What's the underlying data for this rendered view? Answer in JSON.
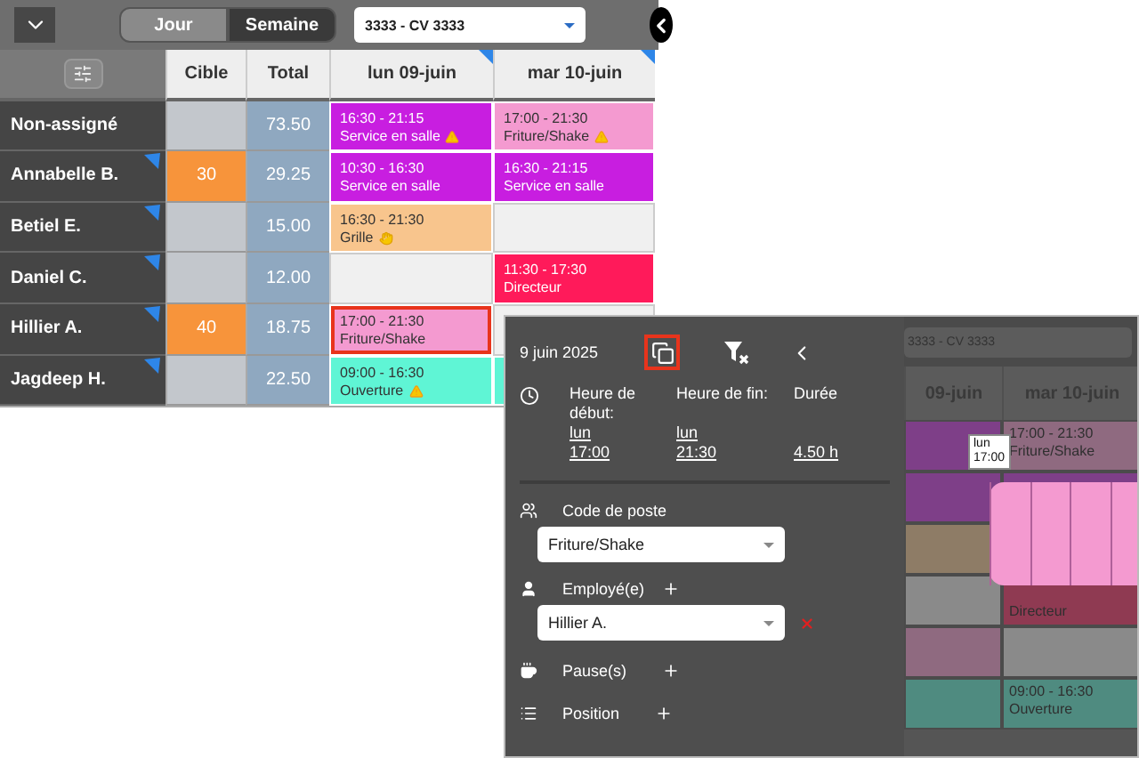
{
  "toolbar": {
    "views": [
      {
        "label": "Jour",
        "selected": false
      },
      {
        "label": "Semaine",
        "selected": true
      }
    ],
    "location": "3333 - CV 3333"
  },
  "grid": {
    "columns": [
      {
        "label": "Cible",
        "kind": "plain"
      },
      {
        "label": "Total",
        "kind": "plain"
      },
      {
        "label": "lun 09-juin",
        "kind": "day",
        "flag": true
      },
      {
        "label": "mar 10-juin",
        "kind": "day",
        "flag": true
      }
    ],
    "rows": [
      {
        "name": "Non-assigné",
        "flag": false,
        "target": "",
        "total": "73.50",
        "shifts": [
          {
            "kind": "shift",
            "time": "16:30 - 21:15",
            "role": "Service en salle",
            "warning": true,
            "hand": false,
            "color": "#c81ee0",
            "selected": false
          },
          {
            "kind": "shift",
            "time": "17:00 - 21:30",
            "role": "Friture/Shake",
            "warning": true,
            "hand": false,
            "color": "#f49ad0",
            "selected": false
          }
        ]
      },
      {
        "name": "Annabelle B.",
        "flag": true,
        "target": "30",
        "total": "29.25",
        "shifts": [
          {
            "kind": "shift",
            "time": "10:30 - 16:30",
            "role": "Service en salle",
            "warning": false,
            "hand": false,
            "color": "#c81ee0",
            "selected": false
          },
          {
            "kind": "shift",
            "time": "16:30 - 21:15",
            "role": "Service en salle",
            "warning": false,
            "hand": false,
            "color": "#c81ee0",
            "selected": false
          }
        ]
      },
      {
        "name": "Betiel E.",
        "flag": true,
        "target": "",
        "total": "15.00",
        "shifts": [
          {
            "kind": "shift",
            "time": "16:30 - 21:30",
            "role": "Grille",
            "warning": false,
            "hand": true,
            "color": "#f8c58d",
            "selected": false
          },
          {
            "kind": "empty"
          }
        ]
      },
      {
        "name": "Daniel C.",
        "flag": true,
        "target": "",
        "total": "12.00",
        "shifts": [
          {
            "kind": "empty"
          },
          {
            "kind": "shift",
            "time": "11:30 - 17:30",
            "role": "Directeur",
            "warning": false,
            "hand": false,
            "color": "#ff1a5a",
            "selected": false
          }
        ]
      },
      {
        "name": "Hillier A.",
        "flag": true,
        "target": "40",
        "total": "18.75",
        "shifts": [
          {
            "kind": "shift",
            "time": "17:00 - 21:30",
            "role": "Friture/Shake",
            "warning": false,
            "hand": false,
            "color": "#f49ad0",
            "selected": true
          },
          {
            "kind": "empty"
          }
        ]
      },
      {
        "name": "Jagdeep H.",
        "flag": true,
        "target": "",
        "total": "22.50",
        "shifts": [
          {
            "kind": "shift",
            "time": "09:00 - 16:30",
            "role": "Ouverture",
            "warning": true,
            "hand": false,
            "color": "#5ff5d5",
            "selected": false
          },
          {
            "kind": "sliver",
            "color": "#5ff5d5"
          }
        ]
      }
    ]
  },
  "editor": {
    "date": "9 juin 2025",
    "copy_highlighted": true,
    "start": {
      "label": "Heure de début:",
      "day": "lun",
      "time": "17:00"
    },
    "end": {
      "label": "Heure de fin:",
      "day": "lun",
      "time": "21:30"
    },
    "duration": {
      "label": "Durée",
      "value": "4.50 h"
    },
    "position_code": {
      "label": "Code de poste",
      "value": "Friture/Shake"
    },
    "employee": {
      "label": "Employé(e)",
      "value": "Hillier A."
    },
    "breaks": {
      "label": "Pause(s)"
    },
    "position": {
      "label": "Position"
    }
  },
  "background_view": {
    "location": "3333 - CV 3333",
    "columns": [
      "09-juin",
      "mar 10-juin"
    ],
    "rows": [
      [
        {
          "color": "#7e3f88"
        },
        {
          "color": "#8f6a80",
          "time": "17:00 - 21:30",
          "role": "Friture/Shake"
        }
      ],
      [
        {
          "color": "#7e3f88"
        },
        {
          "color": "#7e3f88"
        }
      ],
      [
        {
          "color": "#8e7c66"
        },
        {}
      ],
      [
        {
          "color": "#8a8a8a"
        },
        {
          "color": "#8f3a52",
          "role": "Directeur"
        }
      ],
      [
        {
          "color": "#8f6a80"
        },
        {
          "color": "#8a8a8a"
        }
      ],
      [
        {
          "color": "#4f8b80"
        },
        {
          "color": "#4f8b80",
          "time": "09:00 - 16:30",
          "role": "Ouverture"
        }
      ]
    ],
    "tooltip": {
      "day": "lun",
      "time": "17:00"
    }
  }
}
